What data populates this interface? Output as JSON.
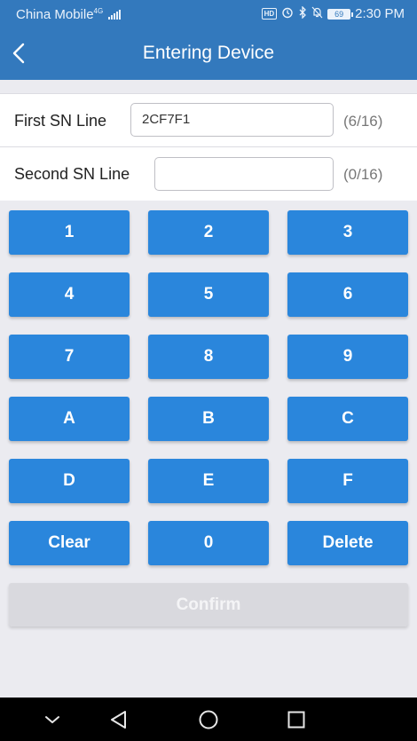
{
  "status_bar": {
    "carrier": "China Mobile",
    "network": "4G",
    "battery": "69",
    "time": "2:30 PM",
    "hd_badge": "HD",
    "icons": [
      "hd-icon",
      "alarm-icon",
      "bluetooth-icon",
      "mute-bell-icon",
      "battery-icon"
    ]
  },
  "header": {
    "title": "Entering Device",
    "back_icon": "chevron-left-icon",
    "background": "#3379bd"
  },
  "form": {
    "first": {
      "label": "First SN Line",
      "value": "2CF7F1",
      "placeholder": "",
      "counter": "(6/16)"
    },
    "second": {
      "label": "Second SN Line",
      "value": "",
      "placeholder": "",
      "counter": "(0/16)"
    }
  },
  "keypad": {
    "keys": [
      "1",
      "2",
      "3",
      "4",
      "5",
      "6",
      "7",
      "8",
      "9",
      "A",
      "B",
      "C",
      "D",
      "E",
      "F",
      "Clear",
      "0",
      "Delete"
    ],
    "key_color": "#2a86dc"
  },
  "confirm": {
    "label": "Confirm",
    "enabled": false,
    "color": "#d9d9de"
  },
  "nav": {
    "icons": [
      "chevron-down-icon",
      "back-triangle-icon",
      "home-circle-icon",
      "recents-square-icon"
    ]
  }
}
